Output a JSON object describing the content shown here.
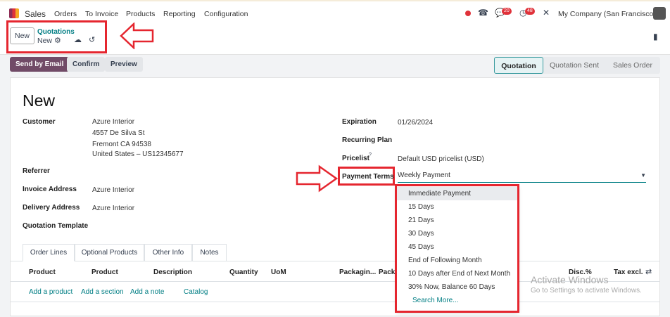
{
  "nav": {
    "app": "Sales",
    "items": [
      "Orders",
      "To Invoice",
      "Products",
      "Reporting",
      "Configuration"
    ],
    "messages_count": "20",
    "activities_count": "48",
    "company": "My Company (San Francisco)"
  },
  "control": {
    "new_label": "New",
    "breadcrumb": "Quotations",
    "record": "New"
  },
  "actions": {
    "send": "Send by Email",
    "confirm": "Confirm",
    "preview": "Preview"
  },
  "status": {
    "stages": [
      "Quotation",
      "Quotation Sent",
      "Sales Order"
    ],
    "active": "Quotation"
  },
  "form": {
    "title": "New",
    "customer_label": "Customer",
    "customer": [
      "Azure Interior",
      "4557 De Silva St",
      "Fremont CA 94538",
      "United States – US12345677"
    ],
    "referrer_label": "Referrer",
    "invoice_address_label": "Invoice Address",
    "invoice_address": "Azure Interior",
    "delivery_address_label": "Delivery Address",
    "delivery_address": "Azure Interior",
    "template_label": "Quotation Template",
    "expiration_label": "Expiration",
    "expiration": "01/26/2024",
    "recurring_label": "Recurring Plan",
    "pricelist_label": "Pricelist",
    "pricelist_help": "?",
    "pricelist": "Default USD pricelist (USD)",
    "payment_terms_label": "Payment Terms",
    "payment_terms": "Weekly Payment"
  },
  "dropdown": {
    "options": [
      "Immediate Payment",
      "15 Days",
      "21 Days",
      "30 Days",
      "45 Days",
      "End of Following Month",
      "10 Days after End of Next Month",
      "30% Now, Balance 60 Days"
    ],
    "search_more": "Search More..."
  },
  "tabs": [
    "Order Lines",
    "Optional Products",
    "Other Info",
    "Notes"
  ],
  "columns": [
    "Product",
    "Product",
    "Description",
    "Quantity",
    "UoM",
    "Packagin...",
    "Packa",
    "Disc.%",
    "Tax excl."
  ],
  "line_actions": [
    "Add a product",
    "Add a section",
    "Add a note",
    "Catalog"
  ],
  "watermark": {
    "title": "Activate Windows",
    "subtitle": "Go to Settings to activate Windows."
  },
  "colors": {
    "primary": "#714b67",
    "link": "#017e84",
    "annotation": "#e5262f"
  }
}
